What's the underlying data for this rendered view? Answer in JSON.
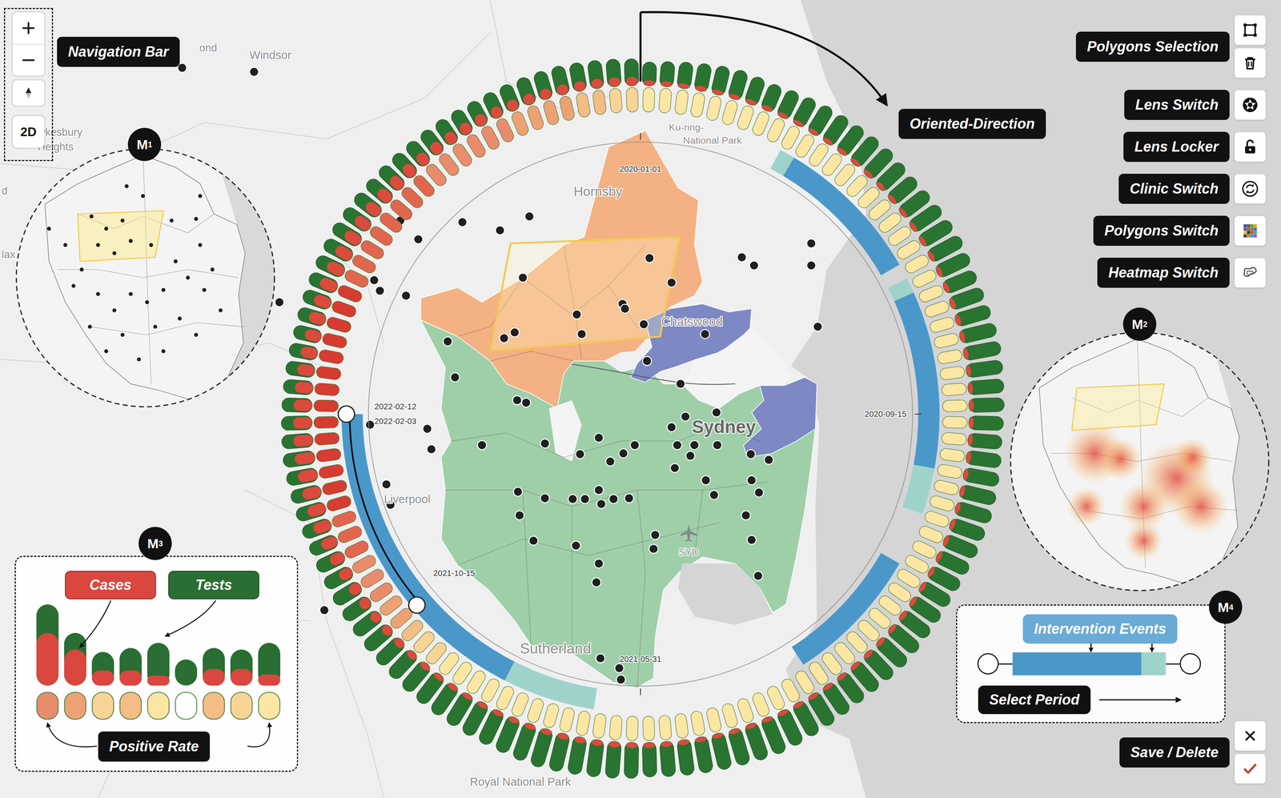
{
  "map": {
    "place_labels": [
      "ond",
      "Windsor",
      "d",
      "wkesbury",
      "Heights",
      "lax",
      "Ku-ring-",
      "National Park",
      "Hornsby",
      "Chatswood",
      "Sydney",
      "Liverpool",
      "SYD",
      "Sutherland",
      "Royal National Park"
    ],
    "regions": [
      {
        "color": "#f4b183"
      },
      {
        "color": "#9fcfa9"
      },
      {
        "color": "#7d88c4"
      },
      {
        "color": "#7d88c4"
      }
    ]
  },
  "navigation": {
    "label": "Navigation Bar",
    "mode": "2D"
  },
  "direction": {
    "label": "Oriented-Direction"
  },
  "toolbar": [
    {
      "label": "Polygons Selection",
      "kind": "selection"
    },
    {
      "label": "Lens Switch",
      "kind": "lens"
    },
    {
      "label": "Lens Locker",
      "kind": "locker"
    },
    {
      "label": "Clinic Switch",
      "kind": "clinic"
    },
    {
      "label": "Polygons Switch",
      "kind": "polygons"
    },
    {
      "label": "Heatmap Switch",
      "kind": "heatmap"
    }
  ],
  "save_delete": {
    "label": "Save / Delete"
  },
  "badges": [
    {
      "letter": "M",
      "index": "1"
    },
    {
      "letter": "M",
      "index": "2"
    },
    {
      "letter": "M",
      "index": "3"
    },
    {
      "letter": "M",
      "index": "4"
    }
  ],
  "chart": {
    "tests": [
      40,
      45,
      50,
      55,
      60,
      62,
      58,
      55,
      60,
      65,
      70,
      72,
      75,
      78,
      80,
      76,
      74,
      78,
      82,
      85,
      88,
      84,
      80,
      82,
      86,
      90,
      92,
      88,
      85,
      83,
      80,
      78,
      82,
      85,
      88,
      90,
      86,
      84,
      80,
      78,
      76,
      78,
      80,
      83,
      85,
      82,
      79,
      77,
      80,
      84,
      88,
      92,
      95,
      93,
      90,
      88,
      86,
      84,
      82,
      80,
      85,
      88,
      90,
      92,
      95,
      97,
      94,
      90,
      88,
      86,
      84,
      82,
      80,
      78,
      76,
      74,
      72,
      70,
      68,
      66,
      64,
      62,
      60,
      62,
      64,
      66,
      68,
      70,
      68,
      66,
      64,
      62,
      60,
      58,
      56,
      58,
      60,
      62,
      64,
      66,
      68,
      66,
      64,
      62,
      60,
      58,
      56,
      55,
      54,
      52,
      50,
      52,
      54,
      56,
      58,
      60,
      58,
      56,
      54,
      52
    ],
    "cases": [
      5,
      4,
      3,
      3,
      2,
      2,
      2,
      2,
      1,
      1,
      1,
      1,
      1,
      2,
      2,
      2,
      1,
      1,
      1,
      1,
      1,
      2,
      2,
      3,
      3,
      2,
      2,
      1,
      1,
      1,
      1,
      1,
      1,
      1,
      1,
      1,
      1,
      1,
      1,
      1,
      1,
      1,
      2,
      2,
      2,
      2,
      1,
      1,
      1,
      1,
      1,
      1,
      1,
      1,
      1,
      1,
      2,
      3,
      4,
      5,
      6,
      7,
      8,
      8,
      7,
      6,
      5,
      5,
      4,
      4,
      4,
      5,
      6,
      10,
      15,
      20,
      26,
      32,
      38,
      44,
      50,
      58,
      66,
      75,
      85,
      92,
      95,
      98,
      100,
      96,
      94,
      92,
      90,
      88,
      85,
      82,
      80,
      78,
      76,
      74,
      72,
      70,
      66,
      62,
      58,
      54,
      50,
      48,
      46,
      44,
      42,
      40,
      38,
      36,
      34,
      32,
      30,
      28,
      26,
      24
    ],
    "positive_rate": [
      1.4,
      1.2,
      1,
      1,
      0.8,
      0.6,
      0.5,
      0.5,
      0.4,
      0.4,
      0.4,
      0.3,
      0.3,
      0.5,
      0.5,
      0.5,
      0.3,
      0.3,
      0.3,
      0.3,
      0.3,
      0.5,
      0.5,
      0.7,
      0.7,
      0.5,
      0.5,
      0.3,
      0.3,
      0.3,
      0.3,
      0.3,
      0.3,
      0.3,
      0.3,
      0.3,
      0.3,
      0.3,
      0.3,
      0.3,
      0.3,
      0.3,
      0.5,
      0.5,
      0.5,
      0.5,
      0.3,
      0.3,
      0.3,
      0.3,
      0.3,
      0.3,
      0.3,
      0.3,
      0.3,
      0.3,
      0.5,
      0.7,
      0.9,
      1,
      1.1,
      1.2,
      1.3,
      1.3,
      1.2,
      1.1,
      1,
      1,
      0.9,
      0.9,
      0.9,
      1,
      1.2,
      2,
      3,
      4,
      5,
      6,
      7,
      8,
      9,
      10,
      12,
      14,
      16,
      18,
      20,
      22,
      24,
      22,
      20,
      19,
      18,
      17,
      16,
      16,
      15,
      15,
      14,
      14,
      13,
      12,
      12,
      11,
      10,
      10,
      9,
      9,
      8,
      8,
      7,
      7,
      6,
      6,
      5,
      5,
      4,
      4,
      3,
      3
    ],
    "axis_labels": [
      {
        "text": "2020-01-01",
        "week": 0
      },
      {
        "text": "2020-09-15",
        "week": 30
      },
      {
        "text": "2021-05-31",
        "week": 60
      }
    ],
    "events": [
      {
        "start": 9.3,
        "end": 10.3,
        "color": "#9ed3cb"
      },
      {
        "start": 10.3,
        "end": 20,
        "color": "#4a98c9"
      },
      {
        "start": 21,
        "end": 22,
        "color": "#9ed3cb"
      },
      {
        "start": 22,
        "end": 33.5,
        "color": "#4a98c9"
      },
      {
        "start": 33.5,
        "end": 36.5,
        "color": "#9ed3cb"
      },
      {
        "start": 40,
        "end": 49,
        "color": "#4a98c9"
      },
      {
        "start": 63,
        "end": 69,
        "color": "#9ed3cb"
      },
      {
        "start": 69,
        "end": 90,
        "color": "#4a98c9"
      }
    ],
    "selection": {
      "start": {
        "label": "2021-10-15",
        "week": 76.5
      },
      "end": {
        "labels": [
          "2022-02-12",
          "2022-02-03"
        ],
        "week": 90
      }
    }
  },
  "legend": {
    "cases_label": "Cases",
    "tests_label": "Tests",
    "rate_label": "Positive Rate",
    "cases": [
      70,
      48,
      20,
      20,
      13,
      0,
      22,
      22,
      15
    ],
    "tests": [
      108,
      70,
      45,
      50,
      57,
      35,
      50,
      48,
      57
    ],
    "positive_rate": [
      8,
      6,
      3,
      4,
      1.2,
      0,
      4,
      3,
      1
    ]
  },
  "intervention_panel": {
    "title": "Intervention Events",
    "action": "Select Period",
    "segments": [
      {
        "share": 0.84,
        "color": "#4a98c9"
      },
      {
        "share": 0.16,
        "color": "#9ed3cb"
      }
    ]
  }
}
